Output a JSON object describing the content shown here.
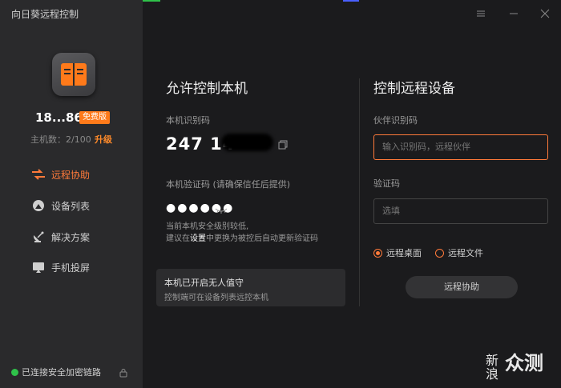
{
  "app": {
    "title": "向日葵远程控制"
  },
  "profile": {
    "user_id": "18...86",
    "badge": "免费版",
    "host_count": "主机数：2/100",
    "upgrade": "升级"
  },
  "nav": [
    {
      "label": "远程协助",
      "icon": "remote-assist-icon",
      "active": true
    },
    {
      "label": "设备列表",
      "icon": "device-list-icon",
      "active": false
    },
    {
      "label": "解决方案",
      "icon": "satellite-icon",
      "active": false
    },
    {
      "label": "手机投屏",
      "icon": "cast-icon",
      "active": false
    }
  ],
  "status": {
    "text": "已连接安全加密链路"
  },
  "allow": {
    "title": "允许控制本机",
    "code_label": "本机识别码",
    "code_value": "247 14",
    "pwd_label": "本机验证码 (请确保信任后提供)",
    "pwd_value": "●●●●●●",
    "warn_line1": "当前本机安全级别较低,",
    "warn_pre": "建议在",
    "warn_link": "设置",
    "warn_post": "中更换为被控后自动更新验证码",
    "notice_title": "本机已开启无人值守",
    "notice_sub": "控制端可在设备列表远控本机"
  },
  "control": {
    "title": "控制远程设备",
    "partner_label": "伙伴识别码",
    "partner_placeholder": "输入识别码，远程伙伴",
    "verify_label": "验证码",
    "verify_placeholder": "选填",
    "radio_desktop": "远程桌面",
    "radio_files": "远程文件",
    "button": "远程协助"
  },
  "watermark": {
    "line1": "新",
    "line2": "浪",
    "big": "众测"
  },
  "colors": {
    "accent": "#ff7a3a",
    "badge": "#ff7a1a",
    "status_ok": "#2fc24a"
  }
}
